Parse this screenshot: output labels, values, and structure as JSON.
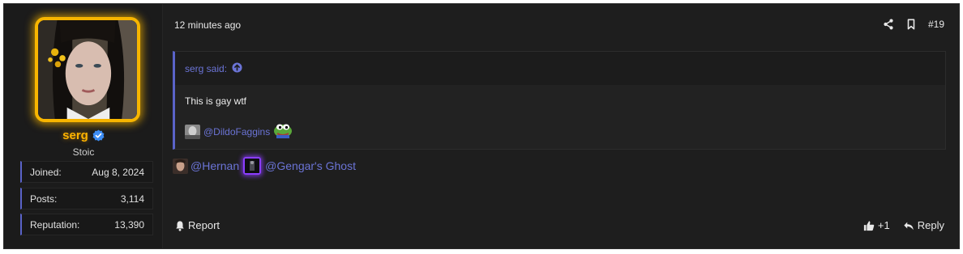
{
  "user": {
    "name": "serg",
    "title": "Stoic",
    "stats": [
      {
        "label": "Joined:",
        "value": "Aug 8, 2024"
      },
      {
        "label": "Posts:",
        "value": "3,114"
      },
      {
        "label": "Reputation:",
        "value": "13,390"
      }
    ]
  },
  "post": {
    "time": "12 minutes ago",
    "number": "#19",
    "quote": {
      "header": "serg said:",
      "text": "This is gay wtf",
      "mention": "@DildoFaggins"
    },
    "mentions": [
      "@Hernan",
      "@Gengar's Ghost"
    ],
    "footer": {
      "report": "Report",
      "like_count": "+1",
      "reply": "Reply"
    }
  },
  "colors": {
    "accent": "#5a63c8",
    "link": "#6b74d6",
    "username": "#ffb400",
    "avatar_frame": "#f7b500",
    "glow_frame": "#8b3dff"
  },
  "icons": [
    "verified-badge-icon",
    "share-icon",
    "bookmark-icon",
    "arrow-up-circle-icon",
    "pepe-frog-icon",
    "bell-icon",
    "thumbs-up-icon",
    "reply-icon"
  ]
}
